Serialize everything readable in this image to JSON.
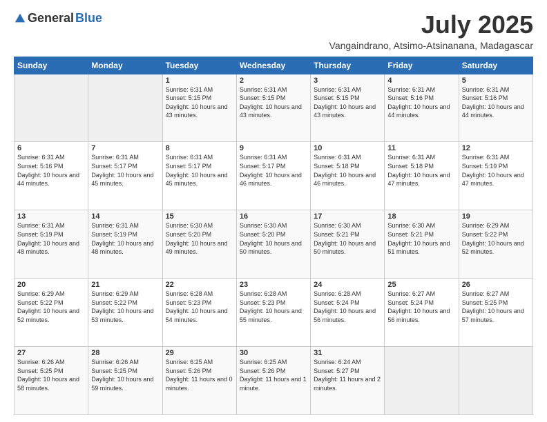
{
  "logo": {
    "general": "General",
    "blue": "Blue"
  },
  "title": "July 2025",
  "subtitle": "Vangaindrano, Atsimo-Atsinanana, Madagascar",
  "days_of_week": [
    "Sunday",
    "Monday",
    "Tuesday",
    "Wednesday",
    "Thursday",
    "Friday",
    "Saturday"
  ],
  "weeks": [
    [
      {
        "day": "",
        "detail": ""
      },
      {
        "day": "",
        "detail": ""
      },
      {
        "day": "1",
        "detail": "Sunrise: 6:31 AM\nSunset: 5:15 PM\nDaylight: 10 hours and 43 minutes."
      },
      {
        "day": "2",
        "detail": "Sunrise: 6:31 AM\nSunset: 5:15 PM\nDaylight: 10 hours and 43 minutes."
      },
      {
        "day": "3",
        "detail": "Sunrise: 6:31 AM\nSunset: 5:15 PM\nDaylight: 10 hours and 43 minutes."
      },
      {
        "day": "4",
        "detail": "Sunrise: 6:31 AM\nSunset: 5:16 PM\nDaylight: 10 hours and 44 minutes."
      },
      {
        "day": "5",
        "detail": "Sunrise: 6:31 AM\nSunset: 5:16 PM\nDaylight: 10 hours and 44 minutes."
      }
    ],
    [
      {
        "day": "6",
        "detail": "Sunrise: 6:31 AM\nSunset: 5:16 PM\nDaylight: 10 hours and 44 minutes."
      },
      {
        "day": "7",
        "detail": "Sunrise: 6:31 AM\nSunset: 5:17 PM\nDaylight: 10 hours and 45 minutes."
      },
      {
        "day": "8",
        "detail": "Sunrise: 6:31 AM\nSunset: 5:17 PM\nDaylight: 10 hours and 45 minutes."
      },
      {
        "day": "9",
        "detail": "Sunrise: 6:31 AM\nSunset: 5:17 PM\nDaylight: 10 hours and 46 minutes."
      },
      {
        "day": "10",
        "detail": "Sunrise: 6:31 AM\nSunset: 5:18 PM\nDaylight: 10 hours and 46 minutes."
      },
      {
        "day": "11",
        "detail": "Sunrise: 6:31 AM\nSunset: 5:18 PM\nDaylight: 10 hours and 47 minutes."
      },
      {
        "day": "12",
        "detail": "Sunrise: 6:31 AM\nSunset: 5:19 PM\nDaylight: 10 hours and 47 minutes."
      }
    ],
    [
      {
        "day": "13",
        "detail": "Sunrise: 6:31 AM\nSunset: 5:19 PM\nDaylight: 10 hours and 48 minutes."
      },
      {
        "day": "14",
        "detail": "Sunrise: 6:31 AM\nSunset: 5:19 PM\nDaylight: 10 hours and 48 minutes."
      },
      {
        "day": "15",
        "detail": "Sunrise: 6:30 AM\nSunset: 5:20 PM\nDaylight: 10 hours and 49 minutes."
      },
      {
        "day": "16",
        "detail": "Sunrise: 6:30 AM\nSunset: 5:20 PM\nDaylight: 10 hours and 50 minutes."
      },
      {
        "day": "17",
        "detail": "Sunrise: 6:30 AM\nSunset: 5:21 PM\nDaylight: 10 hours and 50 minutes."
      },
      {
        "day": "18",
        "detail": "Sunrise: 6:30 AM\nSunset: 5:21 PM\nDaylight: 10 hours and 51 minutes."
      },
      {
        "day": "19",
        "detail": "Sunrise: 6:29 AM\nSunset: 5:22 PM\nDaylight: 10 hours and 52 minutes."
      }
    ],
    [
      {
        "day": "20",
        "detail": "Sunrise: 6:29 AM\nSunset: 5:22 PM\nDaylight: 10 hours and 52 minutes."
      },
      {
        "day": "21",
        "detail": "Sunrise: 6:29 AM\nSunset: 5:22 PM\nDaylight: 10 hours and 53 minutes."
      },
      {
        "day": "22",
        "detail": "Sunrise: 6:28 AM\nSunset: 5:23 PM\nDaylight: 10 hours and 54 minutes."
      },
      {
        "day": "23",
        "detail": "Sunrise: 6:28 AM\nSunset: 5:23 PM\nDaylight: 10 hours and 55 minutes."
      },
      {
        "day": "24",
        "detail": "Sunrise: 6:28 AM\nSunset: 5:24 PM\nDaylight: 10 hours and 56 minutes."
      },
      {
        "day": "25",
        "detail": "Sunrise: 6:27 AM\nSunset: 5:24 PM\nDaylight: 10 hours and 56 minutes."
      },
      {
        "day": "26",
        "detail": "Sunrise: 6:27 AM\nSunset: 5:25 PM\nDaylight: 10 hours and 57 minutes."
      }
    ],
    [
      {
        "day": "27",
        "detail": "Sunrise: 6:26 AM\nSunset: 5:25 PM\nDaylight: 10 hours and 58 minutes."
      },
      {
        "day": "28",
        "detail": "Sunrise: 6:26 AM\nSunset: 5:25 PM\nDaylight: 10 hours and 59 minutes."
      },
      {
        "day": "29",
        "detail": "Sunrise: 6:25 AM\nSunset: 5:26 PM\nDaylight: 11 hours and 0 minutes."
      },
      {
        "day": "30",
        "detail": "Sunrise: 6:25 AM\nSunset: 5:26 PM\nDaylight: 11 hours and 1 minute."
      },
      {
        "day": "31",
        "detail": "Sunrise: 6:24 AM\nSunset: 5:27 PM\nDaylight: 11 hours and 2 minutes."
      },
      {
        "day": "",
        "detail": ""
      },
      {
        "day": "",
        "detail": ""
      }
    ]
  ]
}
